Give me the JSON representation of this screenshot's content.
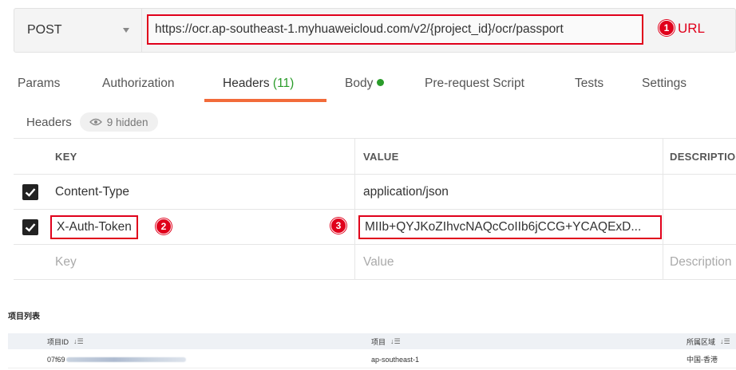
{
  "request": {
    "method": "POST",
    "url": "https://ocr.ap-southeast-1.myhuaweicloud.com/v2/{project_id}/ocr/passport",
    "url_annotation": "URL"
  },
  "annotations": {
    "one": "1",
    "two": "2",
    "three": "3"
  },
  "tabs": [
    {
      "label": "Params"
    },
    {
      "label": "Authorization"
    },
    {
      "label": "Headers ",
      "count": "(11)"
    },
    {
      "label": "Body"
    },
    {
      "label": "Pre-request Script"
    },
    {
      "label": "Tests"
    },
    {
      "label": "Settings"
    }
  ],
  "headers_section": {
    "title": "Headers",
    "hidden": "9 hidden"
  },
  "table": {
    "columns": {
      "key": "KEY",
      "value": "VALUE",
      "description": "DESCRIPTION"
    },
    "rows": [
      {
        "key": "Content-Type",
        "value": "application/json"
      },
      {
        "key": "X-Auth-Token",
        "value": "MIIb+QYJKoZIhvcNAQcCoIIb6jCCG+YCAQExD..."
      }
    ],
    "placeholder": {
      "key": "Key",
      "value": "Value",
      "description": "Description"
    }
  },
  "project_list": {
    "title": "项目列表",
    "columns": {
      "id": "项目ID",
      "project": "项目",
      "region": "所属区域"
    },
    "rows": [
      {
        "id": "07f69",
        "project": "ap-southeast-1",
        "region": "中国-香港"
      }
    ]
  },
  "colors": {
    "highlight": "#e0001b",
    "active_tab": "#f26b3a",
    "green": "#2a9c2a"
  }
}
